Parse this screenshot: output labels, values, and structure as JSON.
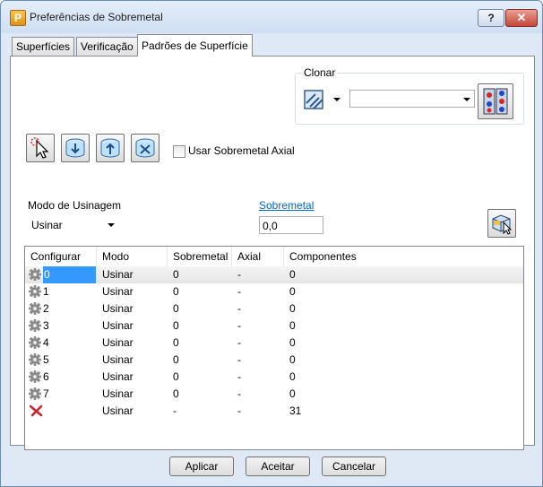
{
  "window": {
    "title": "Preferências de Sobremetal",
    "app_icon_letter": "P",
    "help_label": "?",
    "close_label": "✕"
  },
  "tabs": [
    {
      "label": "Superfícies",
      "active": false
    },
    {
      "label": "Verificação",
      "active": false
    },
    {
      "label": "Padrões de Superfície",
      "active": true
    }
  ],
  "clone_group": {
    "label": "Clonar",
    "dropdown_value": ""
  },
  "axial_checkbox": {
    "label": "Usar Sobremetal Axial",
    "checked": false
  },
  "mode": {
    "label": "Modo de Usinagem",
    "value": "Usinar"
  },
  "allowance": {
    "link_label": "Sobremetal",
    "value": "0,0"
  },
  "table": {
    "columns": [
      "Configurar",
      "Modo",
      "Sobremetal",
      "Axial",
      "Componentes"
    ],
    "rows": [
      {
        "set": "0",
        "mode": "Usinar",
        "allowance": "0",
        "axial": "-",
        "components": "0",
        "icon": "gear-icon"
      },
      {
        "set": "1",
        "mode": "Usinar",
        "allowance": "0",
        "axial": "-",
        "components": "0",
        "icon": "gear-icon"
      },
      {
        "set": "2",
        "mode": "Usinar",
        "allowance": "0",
        "axial": "-",
        "components": "0",
        "icon": "gear-icon"
      },
      {
        "set": "3",
        "mode": "Usinar",
        "allowance": "0",
        "axial": "-",
        "components": "0",
        "icon": "gear-icon"
      },
      {
        "set": "4",
        "mode": "Usinar",
        "allowance": "0",
        "axial": "-",
        "components": "0",
        "icon": "gear-icon"
      },
      {
        "set": "5",
        "mode": "Usinar",
        "allowance": "0",
        "axial": "-",
        "components": "0",
        "icon": "gear-icon"
      },
      {
        "set": "6",
        "mode": "Usinar",
        "allowance": "0",
        "axial": "-",
        "components": "0",
        "icon": "gear-icon"
      },
      {
        "set": "7",
        "mode": "Usinar",
        "allowance": "0",
        "axial": "-",
        "components": "0",
        "icon": "gear-icon"
      },
      {
        "set": "",
        "mode": "Usinar",
        "allowance": "-",
        "axial": "-",
        "components": "31",
        "icon": "red-x-icon"
      }
    ]
  },
  "buttons": {
    "apply": "Aplicar",
    "accept": "Aceitar",
    "cancel": "Cancelar"
  },
  "colors": {
    "selection": "#3399ff",
    "link": "#0066cc"
  }
}
